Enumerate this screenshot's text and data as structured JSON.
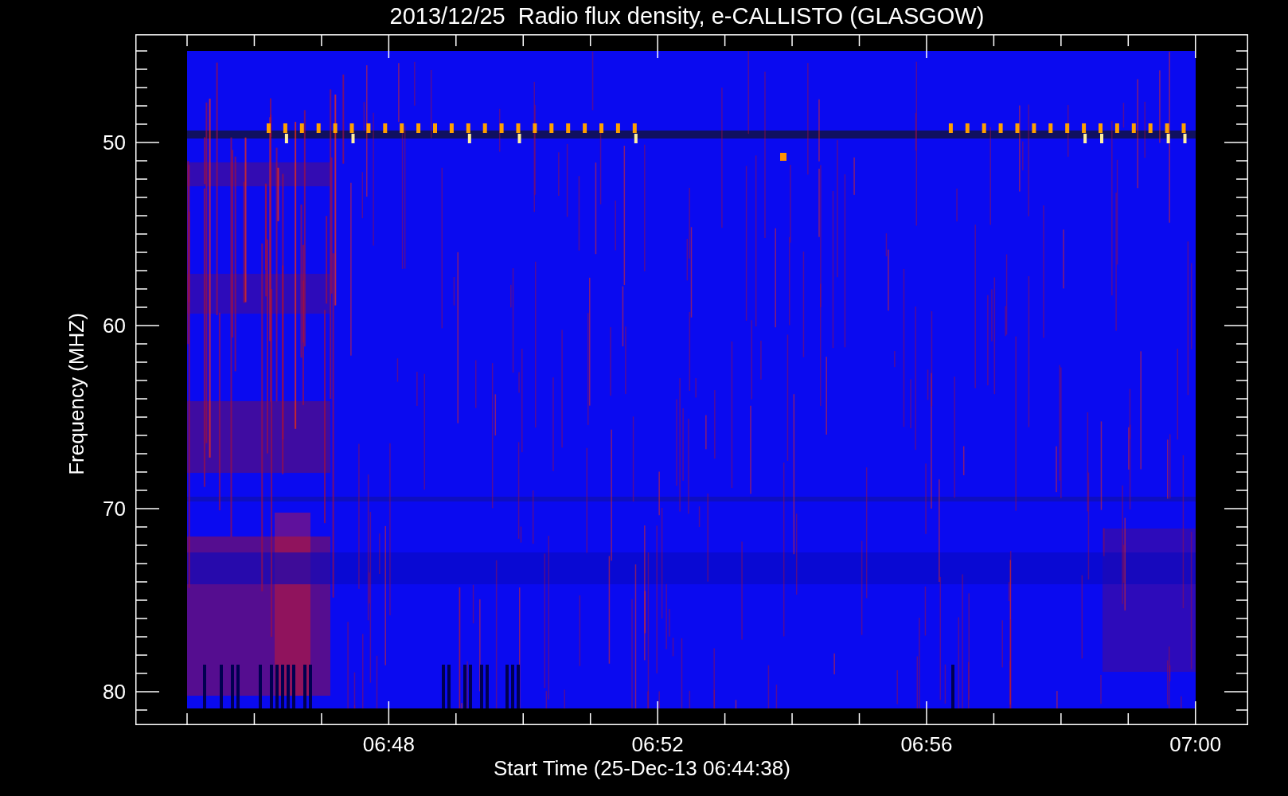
{
  "title": "2013/12/25  Radio flux density, e-CALLISTO (GLASGOW)",
  "y_axis": {
    "label": "Frequency (MHZ)",
    "ticks": [
      "50",
      "60",
      "70",
      "80"
    ]
  },
  "x_axis": {
    "label": "Start Time (25-Dec-13 06:44:38)",
    "ticks": [
      "06:48",
      "06:52",
      "06:56",
      "07:00"
    ]
  }
}
